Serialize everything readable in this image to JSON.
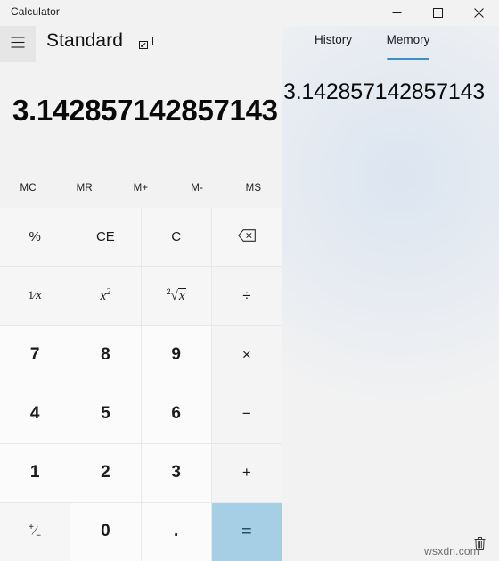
{
  "window": {
    "app_title": "Calculator",
    "caption": {
      "minimize": "minimize-icon",
      "maximize": "maximize-icon",
      "close": "close-icon"
    }
  },
  "header": {
    "nav_toggle_icon": "hamburger-menu-icon",
    "mode_title": "Standard",
    "keep_on_top_icon": "keep-on-top-icon"
  },
  "display": {
    "value": "3.142857142857143"
  },
  "memory_buttons": [
    {
      "label": "MC",
      "name": "memory-clear"
    },
    {
      "label": "MR",
      "name": "memory-recall"
    },
    {
      "label": "M+",
      "name": "memory-add"
    },
    {
      "label": "M-",
      "name": "memory-subtract"
    },
    {
      "label": "MS",
      "name": "memory-store"
    }
  ],
  "keypad": {
    "rows": [
      [
        {
          "label": "%",
          "name": "percent",
          "kind": "fn"
        },
        {
          "label": "CE",
          "name": "clear-entry",
          "kind": "fn"
        },
        {
          "label": "C",
          "name": "clear",
          "kind": "fn"
        },
        {
          "label": "",
          "name": "backspace",
          "kind": "fn",
          "icon": "backspace-icon"
        }
      ],
      [
        {
          "label": "1/x",
          "name": "reciprocal",
          "kind": "fn",
          "glyph": "fraction-one-over-x"
        },
        {
          "label": "x2",
          "name": "square",
          "kind": "fn",
          "glyph": "x-squared"
        },
        {
          "label": "2√x",
          "name": "square-root",
          "kind": "fn",
          "glyph": "square-root-of-x"
        },
        {
          "label": "÷",
          "name": "divide",
          "kind": "op"
        }
      ],
      [
        {
          "label": "7",
          "name": "seven",
          "kind": "num"
        },
        {
          "label": "8",
          "name": "eight",
          "kind": "num"
        },
        {
          "label": "9",
          "name": "nine",
          "kind": "num"
        },
        {
          "label": "×",
          "name": "multiply",
          "kind": "op"
        }
      ],
      [
        {
          "label": "4",
          "name": "four",
          "kind": "num"
        },
        {
          "label": "5",
          "name": "five",
          "kind": "num"
        },
        {
          "label": "6",
          "name": "six",
          "kind": "num"
        },
        {
          "label": "−",
          "name": "subtract",
          "kind": "op"
        }
      ],
      [
        {
          "label": "1",
          "name": "one",
          "kind": "num"
        },
        {
          "label": "2",
          "name": "two",
          "kind": "num"
        },
        {
          "label": "3",
          "name": "three",
          "kind": "num"
        },
        {
          "label": "+",
          "name": "add",
          "kind": "op"
        }
      ],
      [
        {
          "label": "+/−",
          "name": "negate",
          "kind": "fn",
          "glyph": "plus-minus"
        },
        {
          "label": "0",
          "name": "zero",
          "kind": "num"
        },
        {
          "label": ".",
          "name": "decimal-point",
          "kind": "num"
        },
        {
          "label": "=",
          "name": "equals",
          "kind": "equals"
        }
      ]
    ]
  },
  "side_panel": {
    "tabs": [
      {
        "label": "History",
        "name": "tab-history",
        "selected": false
      },
      {
        "label": "Memory",
        "name": "tab-memory",
        "selected": true
      }
    ],
    "memory_items": [
      {
        "value": "3.142857142857143"
      }
    ],
    "clear_all_icon": "trash-icon"
  },
  "watermark": {
    "text": "wsxdn.com"
  },
  "colors": {
    "accent": "#3b8fc4",
    "equals_bg": "#a6cfe6",
    "window_bg": "#f2f2f2",
    "key_bg": "#fafafa"
  }
}
